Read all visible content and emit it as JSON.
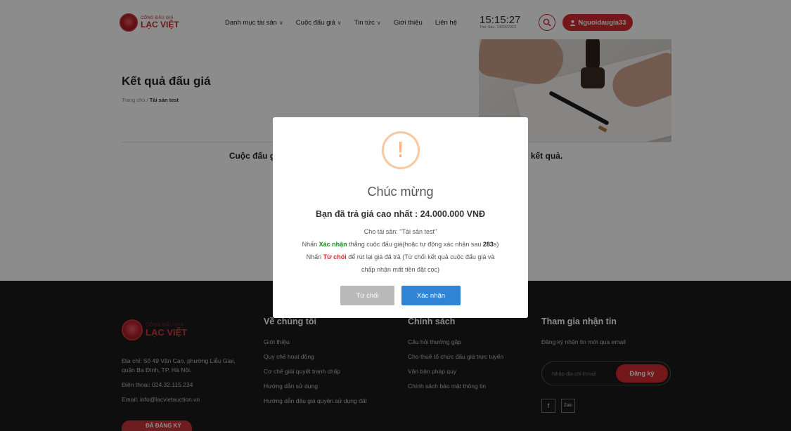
{
  "header": {
    "logo_small": "CỔNG ĐẤU GIÁ",
    "logo_big": "LẠC VIỆT",
    "nav": [
      {
        "label": "Danh mục tài sản",
        "has_dropdown": true
      },
      {
        "label": "Cuộc đấu giá",
        "has_dropdown": true
      },
      {
        "label": "Tin tức",
        "has_dropdown": true
      },
      {
        "label": "Giới thiệu",
        "has_dropdown": false
      },
      {
        "label": "Liên hệ",
        "has_dropdown": false
      }
    ],
    "dropdown_glyph": "∨",
    "clock_time": "15:15:27",
    "clock_date": "Thứ Sáu, 14/04/2023",
    "search_icon": "search-icon",
    "user_icon": "user-icon",
    "user_label": "Nguoidaugia33"
  },
  "page": {
    "title": "Kết quả đấu giá",
    "breadcrumb_home": "Trang chủ",
    "breadcrumb_sep": " / ",
    "breadcrumb_current": "Tài sản test",
    "result_left": "Cuộc đấu g",
    "result_right": "i kết quả."
  },
  "modal": {
    "icon": "warning-icon",
    "icon_glyph": "!",
    "title": "Chúc mừng",
    "headline": "Bạn đã trả giá cao nhất : 24.000.000 VNĐ",
    "asset_line": "Cho tài sản: \"Tài sản test\"",
    "confirm_line_pre": "Nhấn ",
    "confirm_keyword": "Xác nhận",
    "confirm_line_mid": " thắng cuộc đấu giá(hoặc tự động xác nhận sau ",
    "countdown": "283",
    "confirm_line_post": "s)",
    "reject_line_pre": "Nhấn ",
    "reject_keyword": "Từ chối",
    "reject_line_post": " để rút lại giá đã trả (Từ chối kết quả cuộc đấu giá và",
    "reject_line_2": "chấp nhận mất tiền đặt cọc)",
    "reject_button": "Từ chối",
    "confirm_button": "Xác nhận"
  },
  "footer": {
    "logo_small": "CỔNG ĐẤU GIÁ",
    "logo_big": "LẠC VIỆT",
    "address": "Địa chỉ: Số 49 Văn Cao, phường Liễu Giai, quận Ba Đình, TP. Hà Nội.",
    "phone": "Điện thoại: 024.32.115.234",
    "email": "Email: info@lacvietauction.vn",
    "badge": "ĐÃ ĐĂNG KÝ",
    "about": {
      "title": "Về chúng tôi",
      "links": [
        "Giới thiệu",
        "Quy chế hoạt động",
        "Cơ chế giải quyết tranh chấp",
        "Hướng dẫn sử dụng",
        "Hướng dẫn đấu giá quyền sử dụng đất"
      ]
    },
    "policy": {
      "title": "Chính sách",
      "links": [
        "Câu hỏi thường gặp",
        "Cho thuê tổ chức đấu giá trực tuyến",
        "Văn bản pháp quy",
        "Chính sách bảo mật thông tin"
      ]
    },
    "newsletter": {
      "title": "Tham gia nhận tin",
      "desc": "Đăng ký nhận tin mới qua email",
      "placeholder": "Nhập địa chỉ Email",
      "button": "Đăng ký",
      "facebook_glyph": "f",
      "zalo_glyph": "Zalo"
    }
  },
  "colors": {
    "brand_red": "#d22a30",
    "confirm_blue": "#2f84d6",
    "reject_gray": "#b9b9b9",
    "warning_orange": "#f5b07d",
    "footer_bg": "#1b1b1b"
  }
}
